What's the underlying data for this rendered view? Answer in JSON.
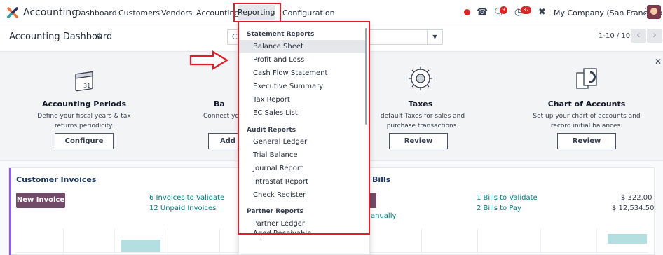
{
  "navbar": {
    "app_name": "Accounting",
    "menu": [
      "Dashboard",
      "Customers",
      "Vendors",
      "Accounting",
      "Reporting",
      "Configuration"
    ],
    "chat_badge": "9",
    "activity_badge": "37",
    "company": "My Company (San Francisco)"
  },
  "control": {
    "title": "Accounting Dashboard",
    "search_lead": "C",
    "pager": "1-10 / 10"
  },
  "onboarding": [
    {
      "title": "Accounting Periods",
      "desc": "Define your fiscal years & tax returns periodicity.",
      "button": "Configure"
    },
    {
      "title": "Ba",
      "desc": "Connect yo",
      "button": "Add a"
    },
    {
      "title": "Taxes",
      "desc": "default Taxes for sales and purchase transactions.",
      "button": "Review"
    },
    {
      "title": "Chart of Accounts",
      "desc": "Set up your chart of accounts and record initial balances.",
      "button": "Review"
    }
  ],
  "customer_invoices": {
    "title": "Customer Invoices",
    "new_button": "New Invoice",
    "to_validate": "6 Invoices to Validate",
    "unpaid": "12 Unpaid Invoices"
  },
  "bills": {
    "title": "Bills",
    "partial_text": "anually",
    "to_validate": "1 Bills to Validate",
    "to_validate_amount": "$ 322.00",
    "to_pay": "2 Bills to Pay",
    "to_pay_amount": "$ 12,534.50"
  },
  "reporting_menu": {
    "sections": [
      {
        "header": "Statement Reports",
        "items": [
          "Balance Sheet",
          "Profit and Loss",
          "Cash Flow Statement",
          "Executive Summary",
          "Tax Report",
          "EC Sales List"
        ]
      },
      {
        "header": "Audit Reports",
        "items": [
          "General Ledger",
          "Trial Balance",
          "Journal Report",
          "Intrastat Report",
          "Check Register"
        ]
      },
      {
        "header": "Partner Reports",
        "items": [
          "Partner Ledger",
          "Aged Receivable"
        ]
      }
    ],
    "active_item": "Balance Sheet"
  },
  "colors": {
    "annotation_red": "#e11d2a",
    "brand": "#714b67",
    "link": "#017e84",
    "chart_bar": "#b4dfe0"
  }
}
